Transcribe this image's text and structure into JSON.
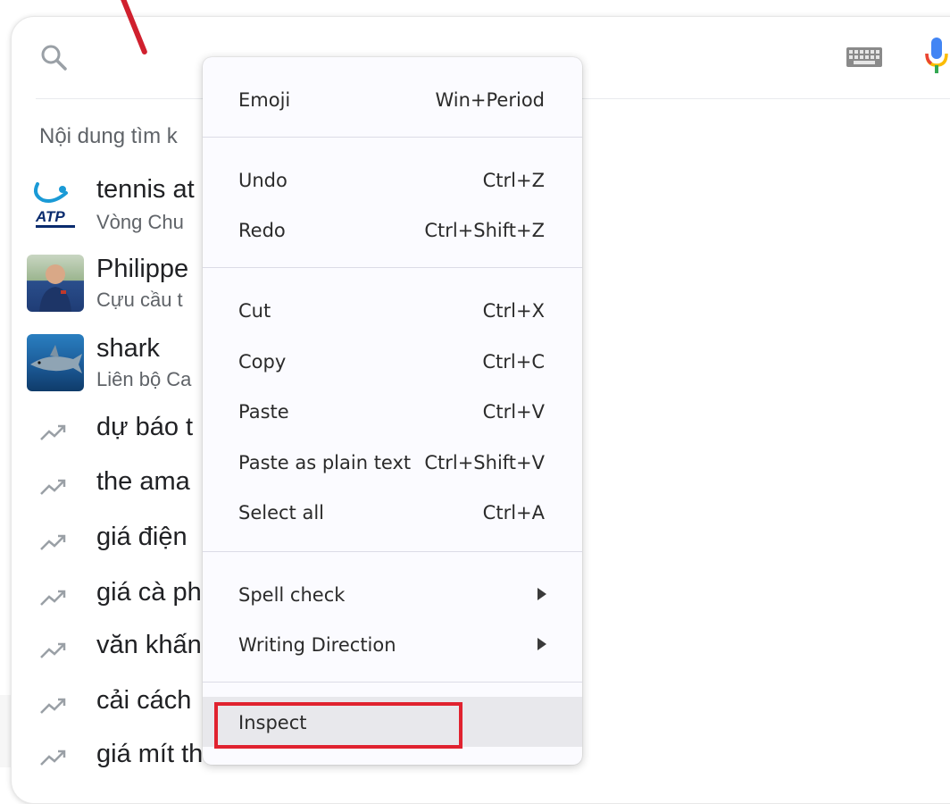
{
  "search": {
    "heading": "Nội dung tìm k"
  },
  "suggestions": [
    {
      "title": "tennis at",
      "subtitle": "Vòng Chu",
      "thumb": "atp-logo"
    },
    {
      "title": "Philippe",
      "subtitle": "Cựu cầu t",
      "thumb": "person-photo"
    },
    {
      "title": "shark",
      "subtitle": "Liên bộ Ca",
      "thumb": "shark-photo"
    }
  ],
  "trending": [
    {
      "text": "dự báo t"
    },
    {
      "text": "the ama"
    },
    {
      "text": "giá điện"
    },
    {
      "text": "giá cà ph"
    },
    {
      "text": "văn khấn"
    },
    {
      "text": "cải cách"
    },
    {
      "text": "giá mít th"
    }
  ],
  "atp_logo_text": "ATP",
  "context_menu": {
    "groups": [
      [
        {
          "label": "Emoji",
          "shortcut": "Win+Period"
        }
      ],
      [
        {
          "label": "Undo",
          "shortcut": "Ctrl+Z"
        },
        {
          "label": "Redo",
          "shortcut": "Ctrl+Shift+Z"
        }
      ],
      [
        {
          "label": "Cut",
          "shortcut": "Ctrl+X"
        },
        {
          "label": "Copy",
          "shortcut": "Ctrl+C"
        },
        {
          "label": "Paste",
          "shortcut": "Ctrl+V"
        },
        {
          "label": "Paste as plain text",
          "shortcut": "Ctrl+Shift+V"
        },
        {
          "label": "Select all",
          "shortcut": "Ctrl+A"
        }
      ],
      [
        {
          "label": "Spell check",
          "submenu": true
        },
        {
          "label": "Writing Direction",
          "submenu": true
        }
      ],
      [
        {
          "label": "Inspect",
          "highlighted": true
        }
      ]
    ]
  },
  "colors": {
    "highlight_box": "#e0222f",
    "annotation_stroke": "#d0202e",
    "menu_bg": "#fbfbff"
  }
}
